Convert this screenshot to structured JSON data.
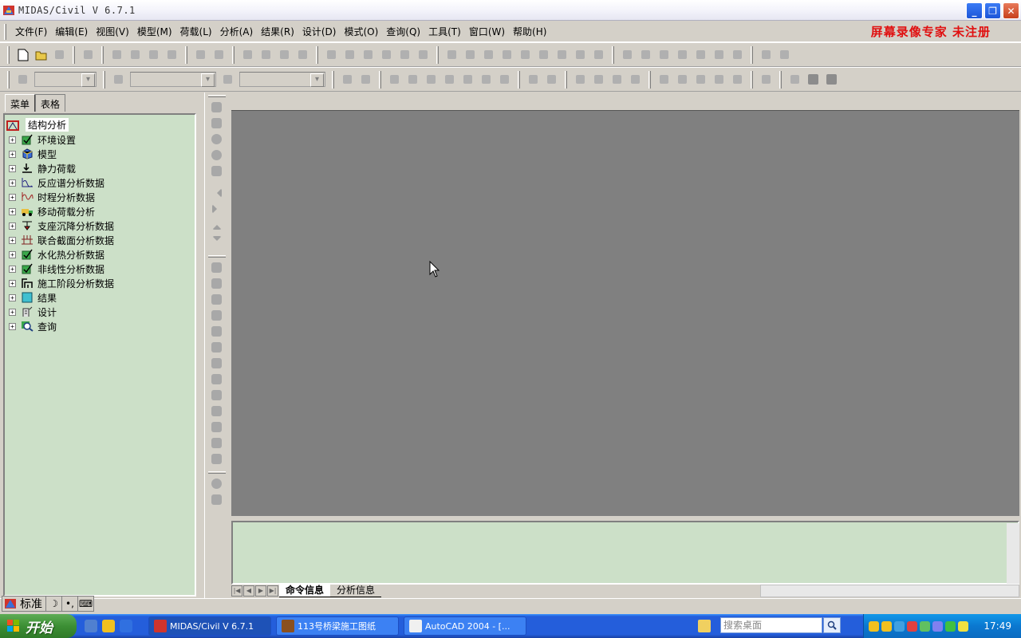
{
  "window": {
    "title": "MIDAS/Civil V 6.7.1",
    "minimize": "_",
    "restore": "❐",
    "close": "✕"
  },
  "menu": {
    "items": [
      "文件(F)",
      "编辑(E)",
      "视图(V)",
      "模型(M)",
      "荷载(L)",
      "分析(A)",
      "结果(R)",
      "设计(D)",
      "模式(O)",
      "查询(Q)",
      "工具(T)",
      "窗口(W)",
      "帮助(H)"
    ],
    "watermark": "屏幕录像专家  未注册"
  },
  "left_panel": {
    "tabs": [
      "菜单",
      "表格"
    ],
    "tree_root": "结构分析",
    "tree_items": [
      {
        "label": "环境设置",
        "icon": "settings-check-icon"
      },
      {
        "label": "模型",
        "icon": "model-cube-icon"
      },
      {
        "label": "静力荷载",
        "icon": "static-load-icon"
      },
      {
        "label": "反应谱分析数据",
        "icon": "spectrum-icon"
      },
      {
        "label": "时程分析数据",
        "icon": "time-history-icon"
      },
      {
        "label": "移动荷载分析",
        "icon": "moving-load-truck-icon"
      },
      {
        "label": "支座沉降分析数据",
        "icon": "support-settlement-icon"
      },
      {
        "label": "联合截面分析数据",
        "icon": "composite-section-icon"
      },
      {
        "label": "水化热分析数据",
        "icon": "heat-hydration-icon"
      },
      {
        "label": "非线性分析数据",
        "icon": "nonlinear-icon"
      },
      {
        "label": "施工阶段分析数据",
        "icon": "construction-stage-icon"
      },
      {
        "label": "结果",
        "icon": "results-icon"
      },
      {
        "label": "设计",
        "icon": "design-icon"
      },
      {
        "label": "查询",
        "icon": "query-icon"
      }
    ],
    "expander": "+"
  },
  "message": {
    "tabs": [
      "命令信息",
      "分析信息"
    ]
  },
  "ime": {
    "mode": "标准",
    "moon": "☽",
    "punct": "•,",
    "keyboard": "⌨"
  },
  "taskbar": {
    "start": "开始",
    "tasks": [
      "MIDAS/Civil V 6.7.1",
      "113号桥梁施工图纸",
      "AutoCAD 2004 - [..."
    ],
    "search_placeholder": "搜索桌面",
    "clock": "17:49"
  },
  "colors": {
    "tree_bg": "#cce0c8",
    "viewport": "#808080",
    "watermark": "#e01010",
    "taskbar": "#245edb"
  }
}
